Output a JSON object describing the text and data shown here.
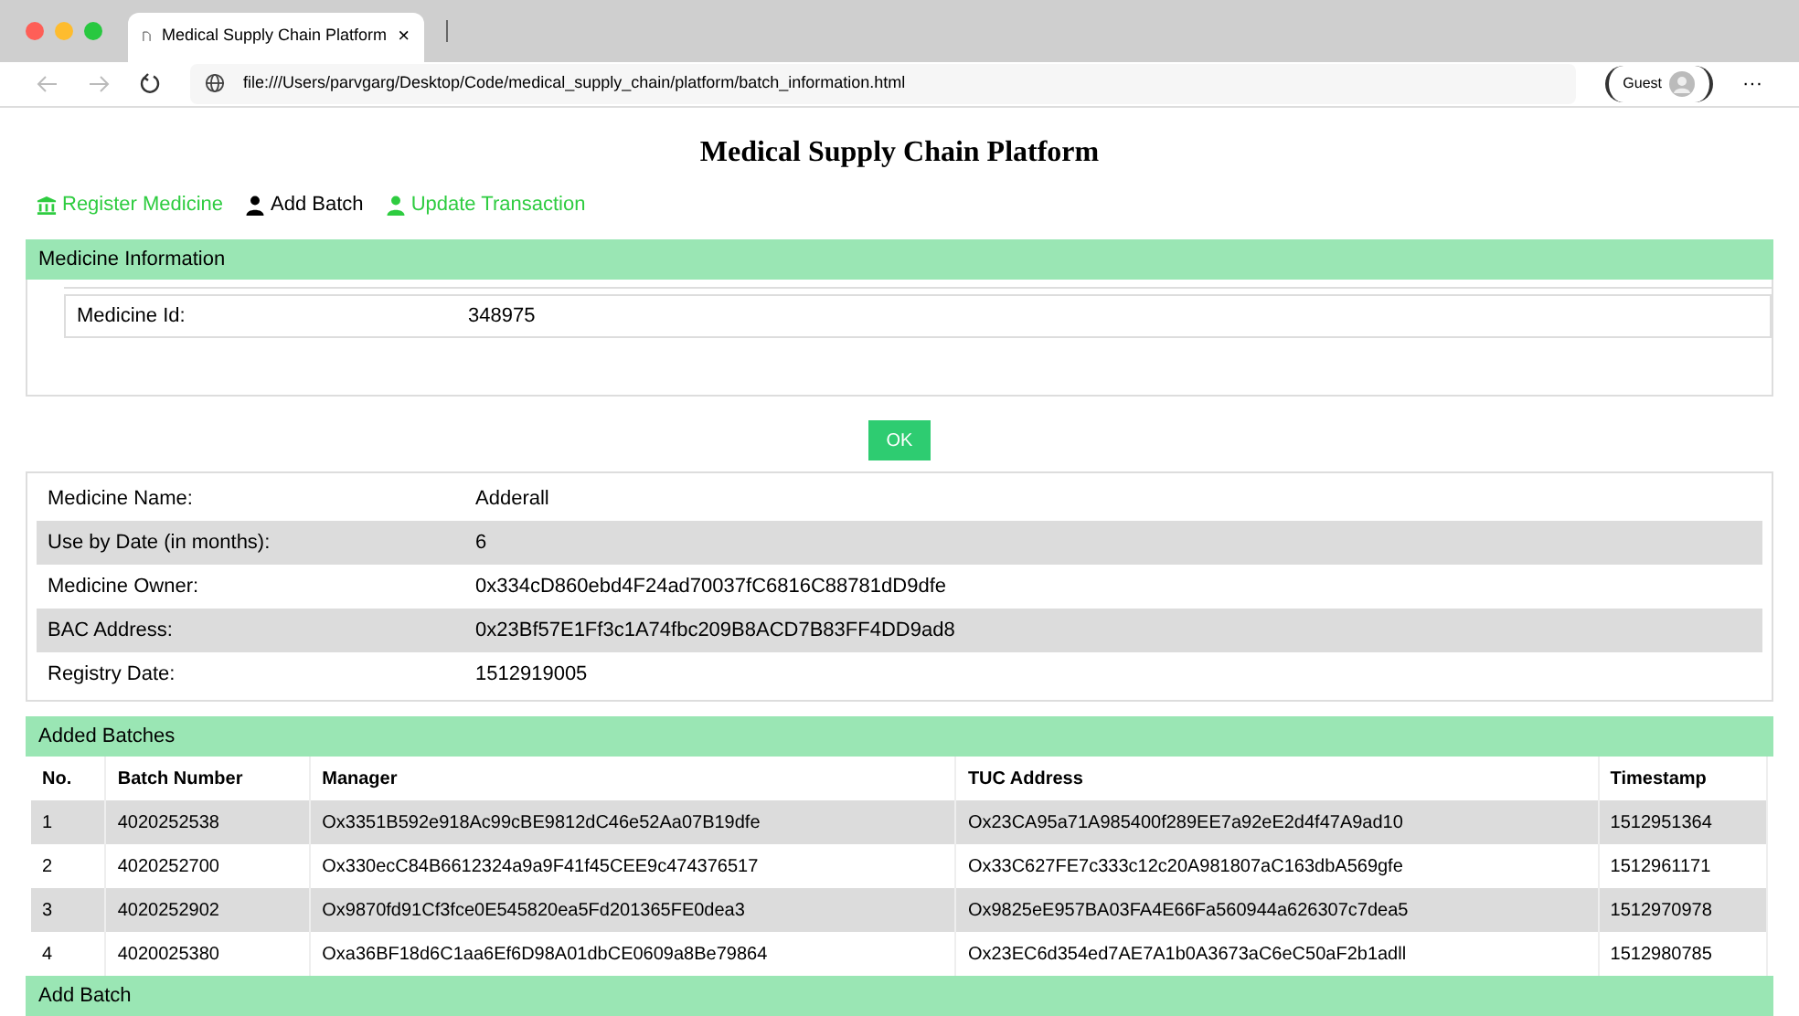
{
  "browser": {
    "tab_title": "Medical Supply Chain Platform",
    "tab_close": "×",
    "address": "file:///Users/parvgarg/Desktop/Code/medical_supply_chain/platform/batch_information.html",
    "profile": "Guest",
    "menu": "···"
  },
  "page_title": "Medical Supply Chain Platform",
  "nav": [
    {
      "label": "Register Medicine",
      "kind": "bank",
      "selected": false
    },
    {
      "label": "Add Batch",
      "kind": "user",
      "selected": true
    },
    {
      "label": "Update Transaction",
      "kind": "user",
      "selected": false
    }
  ],
  "medicine_information": {
    "header": "Medicine Information",
    "label": "Medicine Id:",
    "value": "348975"
  },
  "ok_button": "OK",
  "details": [
    {
      "label": "Medicine Name:",
      "value": "Adderall"
    },
    {
      "label": "Use by Date (in months):",
      "value": "6"
    },
    {
      "label": "Medicine Owner:",
      "value": "0x334cD860ebd4F24ad70037fC6816C88781dD9dfe"
    },
    {
      "label": "BAC Address:",
      "value": "0x23Bf57E1Ff3c1A74fbc209B8ACD7B83FF4DD9ad8"
    },
    {
      "label": "Registry Date:",
      "value": "1512919005"
    }
  ],
  "added_batches": {
    "header": "Added Batches",
    "columns": [
      "No.",
      "Batch Number",
      "Manager",
      "TUC Address",
      "Timestamp"
    ],
    "rows": [
      [
        "1",
        "4020252538",
        "Ox3351B592e918Ac99cBE9812dC46e52Aa07B19dfe",
        "Ox23CA95a71A985400f289EE7a92eE2d4f47A9ad10",
        "1512951364"
      ],
      [
        "2",
        "4020252700",
        "Ox330ecC84B6612324a9a9F41f45CEE9c474376517",
        "Ox33C627FE7c333c12c20A981807aC163dbA569gfe",
        "1512961171"
      ],
      [
        "3",
        "4020252902",
        "Ox9870fd91Cf3fce0E545820ea5Fd201365FE0dea3",
        "Ox9825eE957BA03FA4E66Fa560944a626307c7dea5",
        "1512970978"
      ],
      [
        "4",
        "4020025380",
        "Oxa36BF18d6C1aa6Ef6D98A01dbCE0609a8Be79864",
        "Ox23EC6d354ed7AE7A1b0A3673aC6eC50aF2b1adll",
        "1512980785"
      ]
    ]
  },
  "add_batch_header": "Add Batch"
}
